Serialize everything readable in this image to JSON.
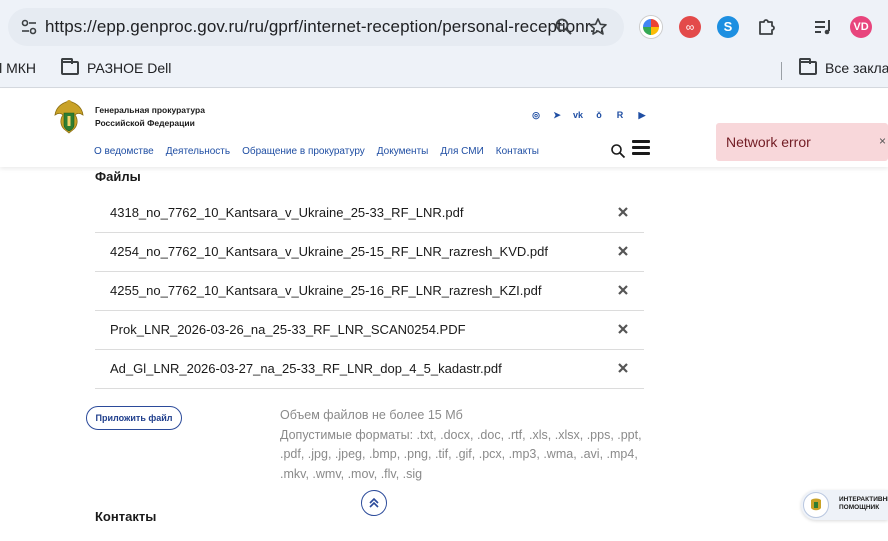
{
  "browser": {
    "url": "https://epp.genproc.gov.ru/ru/gprf/internet-reception/personal-receptionr...",
    "profile_initials": "VD",
    "bookmarks": [
      {
        "label": "ll МКН"
      },
      {
        "label": "РАЗНОЕ Dell"
      },
      {
        "label": "Все заклад"
      }
    ]
  },
  "site": {
    "org_line1": "Генеральная прокуратура",
    "org_line2": "Российской Федерации",
    "social": [
      {
        "icon": "max-icon",
        "glyph": "◎"
      },
      {
        "icon": "telegram-icon",
        "glyph": "➤"
      },
      {
        "icon": "vk-icon",
        "glyph": "vk"
      },
      {
        "icon": "ok-icon",
        "glyph": "ǒ"
      },
      {
        "icon": "rutube-icon",
        "glyph": "R"
      },
      {
        "icon": "youtube-icon",
        "glyph": "▶"
      }
    ],
    "nav": [
      {
        "label": "О ведомстве"
      },
      {
        "label": "Деятельность"
      },
      {
        "label": "Обращение в прокуратуру"
      },
      {
        "label": "Документы"
      },
      {
        "label": "Для СМИ"
      },
      {
        "label": "Контакты"
      }
    ]
  },
  "toast": {
    "message": "Network error",
    "close": "×"
  },
  "files_section": {
    "title": "Файлы",
    "files": [
      {
        "name": "4318_no_7762_10_Kantsara_v_Ukraine_25-33_RF_LNR.pdf"
      },
      {
        "name": "4254_no_7762_10_Kantsara_v_Ukraine_25-15_RF_LNR_razresh_KVD.pdf"
      },
      {
        "name": "4255_no_7762_10_Kantsara_v_Ukraine_25-16_RF_LNR_razresh_KZI.pdf"
      },
      {
        "name": "Prok_LNR_2026-03-26_na_25-33_RF_LNR_SCAN0254.PDF"
      },
      {
        "name": "Ad_Gl_LNR_2026-03-27_na_25-33_RF_LNR_dop_4_5_kadastr.pdf"
      }
    ],
    "attach_label": "Приложить файл",
    "size_hint": "Объем файлов не более 15 Мб",
    "formats_hint": "Допустимые форматы: .txt, .docx, .doc, .rtf, .xls, .xlsx, .pps, .ppt, .pdf, .jpg, .jpeg, .bmp, .png, .tif, .gif, .pcx, .mp3, .wma, .avi, .mp4, .mkv, .wmv, .mov, .flv, .sig"
  },
  "contacts_section": {
    "title": "Контакты"
  },
  "assistant": {
    "line1": "ИНТЕРАКТИВНЫЙ",
    "line2": "ПОМОЩНИК"
  }
}
